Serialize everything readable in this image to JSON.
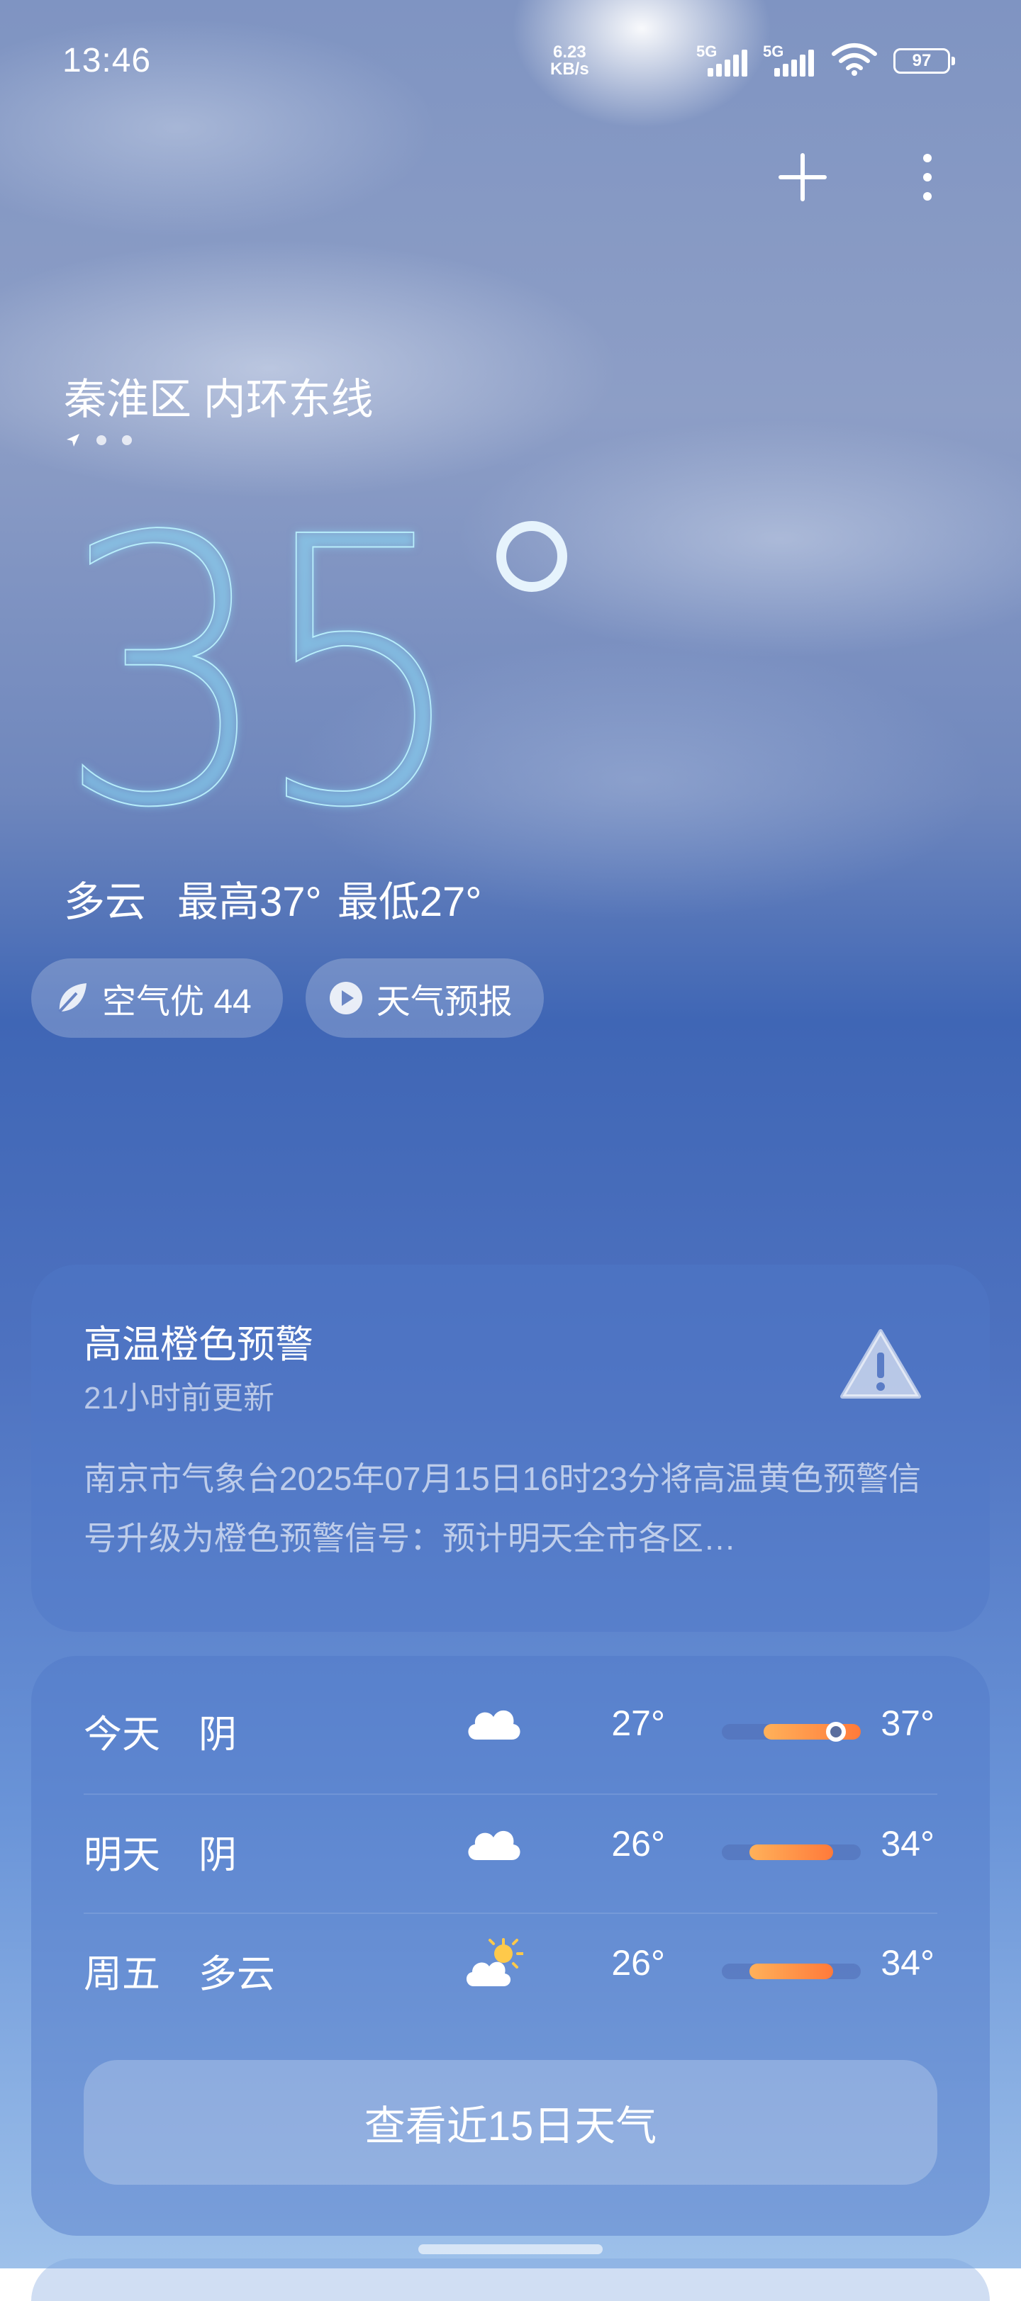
{
  "status_bar": {
    "time": "13:46",
    "net_speed_value": "6.23",
    "net_speed_unit": "KB/s",
    "sim1_tag": "5G",
    "sim2_tag": "5G",
    "battery": "97"
  },
  "location": {
    "name": "秦淮区 内环东线",
    "page_dots": [
      "location-arrow",
      "dot",
      "dot"
    ]
  },
  "current": {
    "temperature": "35",
    "condition": "多云",
    "high": "最高37°",
    "low": "最低27°"
  },
  "pills": {
    "air_quality": "空气优 44",
    "forecast_video": "天气预报"
  },
  "alert": {
    "title": "高温橙色预警",
    "updated": "21小时前更新",
    "body": "南京市气象台2025年07月15日16时23分将高温黄色预警信号升级为橙色预警信号：预计明天全市各区…",
    "icon": "warning-icon"
  },
  "forecast": {
    "days": [
      {
        "day": "今天",
        "condition": "阴",
        "icon": "cloud-icon",
        "low": "27°",
        "high": "37°",
        "range_start": 0.3,
        "range_end": 1.0,
        "current_marker": 0.82
      },
      {
        "day": "明天",
        "condition": "阴",
        "icon": "cloud-icon",
        "low": "26°",
        "high": "34°",
        "range_start": 0.2,
        "range_end": 0.8
      },
      {
        "day": "周五",
        "condition": "多云",
        "icon": "partly-sunny-icon",
        "low": "26°",
        "high": "34°",
        "range_start": 0.2,
        "range_end": 0.8
      }
    ],
    "more_button": "查看近15日天气"
  },
  "colors": {
    "bar_start": "#ffb15a",
    "bar_end": "#ff7a3a",
    "sky_top": "#7f94c2",
    "sky_mid": "#3f66b5",
    "sky_bottom": "#9ec1ea"
  }
}
